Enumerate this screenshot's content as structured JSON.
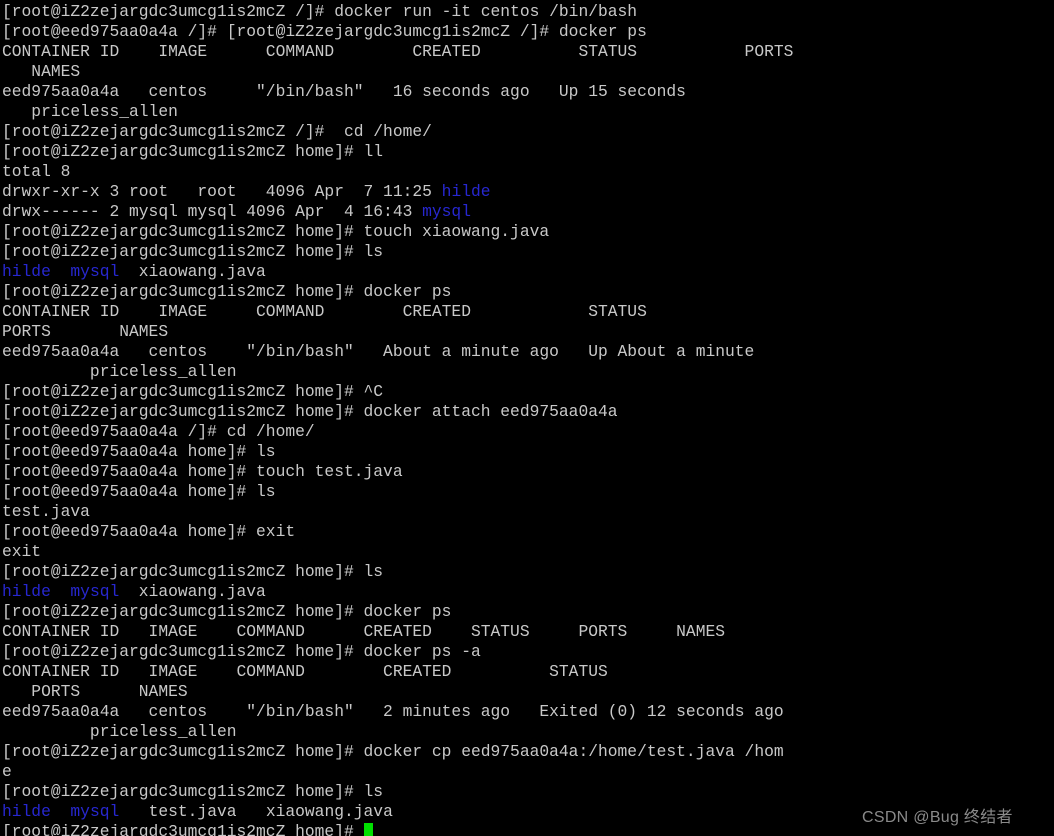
{
  "terminal": {
    "background_color": "#000000",
    "foreground_color": "#c8c8c8",
    "directory_color": "#2727d0",
    "cursor_color": "#00e000",
    "host_prompt": "[root@iZ2zejargdc3umcg1is2mcZ",
    "container_prompt": "[root@eed975aa0a4a",
    "container_id": "eed975aa0a4a",
    "container_image": "centos",
    "container_command": "\"/bin/bash\"",
    "container_name": "priceless_allen",
    "lines": [
      {
        "id": "l01",
        "segments": [
          {
            "text": "[root@iZ2zejargdc3umcg1is2mcZ /]# docker run -it centos /bin/bash",
            "color": "default"
          }
        ]
      },
      {
        "id": "l02",
        "segments": [
          {
            "text": "[root@eed975aa0a4a /]# [root@iZ2zejargdc3umcg1is2mcZ /]# docker ps",
            "color": "default"
          }
        ]
      },
      {
        "id": "l03",
        "segments": [
          {
            "text": "CONTAINER ID    IMAGE      COMMAND        CREATED          STATUS           PORTS",
            "color": "default"
          }
        ]
      },
      {
        "id": "l04",
        "segments": [
          {
            "text": "   NAMES",
            "color": "default"
          }
        ]
      },
      {
        "id": "l05",
        "segments": [
          {
            "text": "eed975aa0a4a   centos     \"/bin/bash\"   16 seconds ago   Up 15 seconds",
            "color": "default"
          }
        ]
      },
      {
        "id": "l06",
        "segments": [
          {
            "text": "   priceless_allen",
            "color": "default"
          }
        ]
      },
      {
        "id": "l07",
        "segments": [
          {
            "text": "[root@iZ2zejargdc3umcg1is2mcZ /]#  cd /home/",
            "color": "default"
          }
        ]
      },
      {
        "id": "l08",
        "segments": [
          {
            "text": "[root@iZ2zejargdc3umcg1is2mcZ home]# ll",
            "color": "default"
          }
        ]
      },
      {
        "id": "l09",
        "segments": [
          {
            "text": "total 8",
            "color": "default"
          }
        ]
      },
      {
        "id": "l10",
        "segments": [
          {
            "text": "drwxr-xr-x 3 root   root   4096 Apr  7 11:25 ",
            "color": "default"
          },
          {
            "text": "hilde",
            "color": "dir"
          }
        ]
      },
      {
        "id": "l11",
        "segments": [
          {
            "text": "drwx------ 2 mysql mysql 4096 Apr  4 16:43 ",
            "color": "default"
          },
          {
            "text": "mysql",
            "color": "dir"
          }
        ]
      },
      {
        "id": "l12",
        "segments": [
          {
            "text": "[root@iZ2zejargdc3umcg1is2mcZ home]# touch xiaowang.java",
            "color": "default"
          }
        ]
      },
      {
        "id": "l13",
        "segments": [
          {
            "text": "[root@iZ2zejargdc3umcg1is2mcZ home]# ls",
            "color": "default"
          }
        ]
      },
      {
        "id": "l14",
        "segments": [
          {
            "text": "hilde",
            "color": "dir"
          },
          {
            "text": "  ",
            "color": "default"
          },
          {
            "text": "mysql",
            "color": "dir"
          },
          {
            "text": "  xiaowang.java",
            "color": "default"
          }
        ]
      },
      {
        "id": "l15",
        "segments": [
          {
            "text": "[root@iZ2zejargdc3umcg1is2mcZ home]# docker ps",
            "color": "default"
          }
        ]
      },
      {
        "id": "l16",
        "segments": [
          {
            "text": "CONTAINER ID    IMAGE     COMMAND        CREATED            STATUS",
            "color": "default"
          }
        ]
      },
      {
        "id": "l17",
        "segments": [
          {
            "text": "PORTS       NAMES",
            "color": "default"
          }
        ]
      },
      {
        "id": "l18",
        "segments": [
          {
            "text": "eed975aa0a4a   centos    \"/bin/bash\"   About a minute ago   Up About a minute",
            "color": "default"
          }
        ]
      },
      {
        "id": "l19",
        "segments": [
          {
            "text": "         priceless_allen",
            "color": "default"
          }
        ]
      },
      {
        "id": "l20",
        "segments": [
          {
            "text": "[root@iZ2zejargdc3umcg1is2mcZ home]# ^C",
            "color": "default"
          }
        ]
      },
      {
        "id": "l21",
        "segments": [
          {
            "text": "[root@iZ2zejargdc3umcg1is2mcZ home]# docker attach eed975aa0a4a",
            "color": "default"
          }
        ]
      },
      {
        "id": "l22",
        "segments": [
          {
            "text": "[root@eed975aa0a4a /]# cd /home/",
            "color": "default"
          }
        ]
      },
      {
        "id": "l23",
        "segments": [
          {
            "text": "[root@eed975aa0a4a home]# ls",
            "color": "default"
          }
        ]
      },
      {
        "id": "l24",
        "segments": [
          {
            "text": "[root@eed975aa0a4a home]# touch test.java",
            "color": "default"
          }
        ]
      },
      {
        "id": "l25",
        "segments": [
          {
            "text": "[root@eed975aa0a4a home]# ls",
            "color": "default"
          }
        ]
      },
      {
        "id": "l26",
        "segments": [
          {
            "text": "test.java",
            "color": "default"
          }
        ]
      },
      {
        "id": "l27",
        "segments": [
          {
            "text": "[root@eed975aa0a4a home]# exit",
            "color": "default"
          }
        ]
      },
      {
        "id": "l28",
        "segments": [
          {
            "text": "exit",
            "color": "default"
          }
        ]
      },
      {
        "id": "l29",
        "segments": [
          {
            "text": "[root@iZ2zejargdc3umcg1is2mcZ home]# ls",
            "color": "default"
          }
        ]
      },
      {
        "id": "l30",
        "segments": [
          {
            "text": "hilde",
            "color": "dir"
          },
          {
            "text": "  ",
            "color": "default"
          },
          {
            "text": "mysql",
            "color": "dir"
          },
          {
            "text": "  xiaowang.java",
            "color": "default"
          }
        ]
      },
      {
        "id": "l31",
        "segments": [
          {
            "text": "[root@iZ2zejargdc3umcg1is2mcZ home]# docker ps",
            "color": "default"
          }
        ]
      },
      {
        "id": "l32",
        "segments": [
          {
            "text": "CONTAINER ID   IMAGE    COMMAND      CREATED    STATUS     PORTS     NAMES",
            "color": "default"
          }
        ]
      },
      {
        "id": "l33",
        "segments": [
          {
            "text": "[root@iZ2zejargdc3umcg1is2mcZ home]# docker ps -a",
            "color": "default"
          }
        ]
      },
      {
        "id": "l34",
        "segments": [
          {
            "text": "CONTAINER ID   IMAGE    COMMAND        CREATED          STATUS",
            "color": "default"
          }
        ]
      },
      {
        "id": "l35",
        "segments": [
          {
            "text": "   PORTS      NAMES",
            "color": "default"
          }
        ]
      },
      {
        "id": "l36",
        "segments": [
          {
            "text": "eed975aa0a4a   centos    \"/bin/bash\"   2 minutes ago   Exited (0) 12 seconds ago",
            "color": "default"
          }
        ]
      },
      {
        "id": "l37",
        "segments": [
          {
            "text": "         priceless_allen",
            "color": "default"
          }
        ]
      },
      {
        "id": "l38",
        "segments": [
          {
            "text": "[root@iZ2zejargdc3umcg1is2mcZ home]# docker cp eed975aa0a4a:/home/test.java /hom",
            "color": "default"
          }
        ]
      },
      {
        "id": "l39",
        "segments": [
          {
            "text": "e",
            "color": "default"
          }
        ]
      },
      {
        "id": "l40",
        "segments": [
          {
            "text": "[root@iZ2zejargdc3umcg1is2mcZ home]# ls",
            "color": "default"
          }
        ]
      },
      {
        "id": "l41",
        "segments": [
          {
            "text": "hilde",
            "color": "dir"
          },
          {
            "text": "  ",
            "color": "default"
          },
          {
            "text": "mysql",
            "color": "dir"
          },
          {
            "text": "   test.java   xiaowang.java",
            "color": "default"
          }
        ]
      },
      {
        "id": "l42",
        "segments": [
          {
            "text": "[root@iZ2zejargdc3umcg1is2mcZ home]# ",
            "color": "default"
          }
        ],
        "cursor": true
      }
    ]
  },
  "watermark": {
    "text": "CSDN @Bug 终结者"
  }
}
